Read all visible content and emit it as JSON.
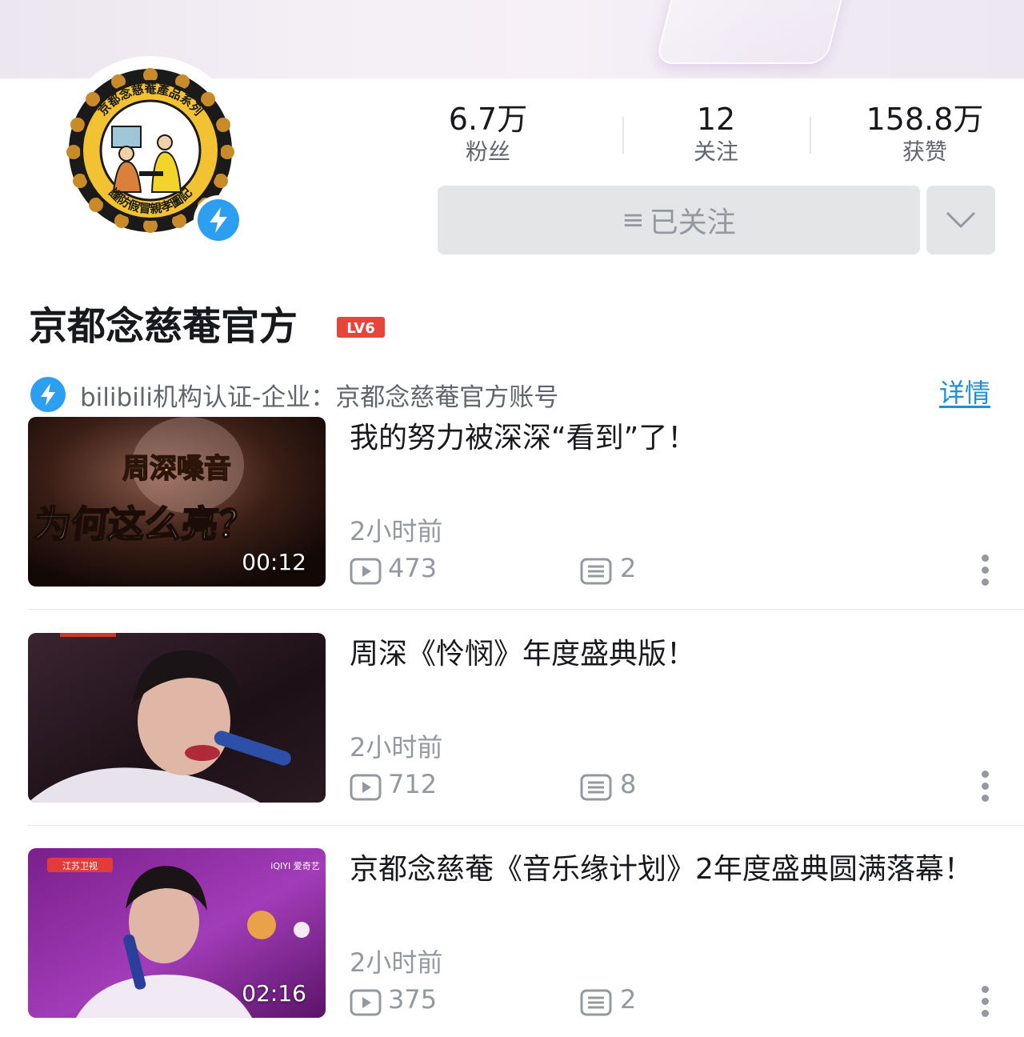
{
  "profile": {
    "name": "京都念慈菴官方",
    "level": "LV6",
    "stats": {
      "fans_value": "6.7万",
      "fans_label": "粉丝",
      "following_value": "12",
      "following_label": "关注",
      "likes_value": "158.8万",
      "likes_label": "获赞"
    },
    "follow_button_label": "已关注",
    "verification_text": "bilibili机构认证-企业：京都念慈菴官方账号",
    "details_link": "详情",
    "avatar_text": {
      "top": "京都念慈菴產品系列",
      "bottom": "謹防假冒親孝圖記"
    }
  },
  "videos": [
    {
      "title": "我的努力被深深“看到”了！",
      "thumbnail_text_1": "周深嗓音",
      "thumbnail_text_2": "为何这么亮？",
      "duration": "00:12",
      "time": "2小时前",
      "views": "473",
      "comments": "2"
    },
    {
      "title": "周深《怜悯》年度盛典版！",
      "duration": "",
      "time": "2小时前",
      "views": "712",
      "comments": "8"
    },
    {
      "title": "京都念慈菴《音乐缘计划》2年度盛典圆满落幕！",
      "thumbnail_logo_left": "江苏卫视",
      "thumbnail_logo_right": "iQIYI 爱奇艺",
      "duration": "02:16",
      "time": "2小时前",
      "views": "375",
      "comments": "2"
    }
  ],
  "colors": {
    "accent_blue": "#2d9ff0",
    "link_blue": "#1e90d6",
    "level_red": "#e8443a",
    "secondary_text": "#9499a0",
    "button_bg": "#e3e5e7"
  }
}
